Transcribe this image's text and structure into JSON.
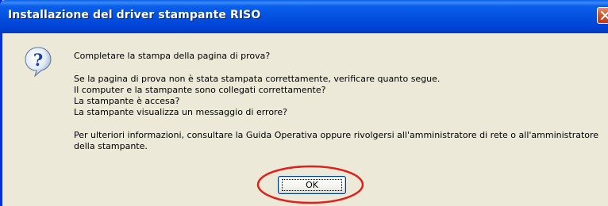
{
  "window": {
    "title": "Installazione del driver stampante RISO"
  },
  "icons": {
    "close": "close-icon",
    "question": "question-icon"
  },
  "message": {
    "question": "Completare la stampa della pagina di prova?",
    "intro": "Se la pagina di prova non è stata stampata correttamente, verificare quanto segue.",
    "checks": [
      " Il computer e la stampante sono collegati correttamente?",
      " La stampante è accesa?",
      " La stampante visualizza un messaggio di errore?"
    ],
    "info_line1": "Per ulteriori informazioni, consultare la Guida Operativa oppure rivolgersi all'amministratore di rete o all'amministratore",
    "info_line2": "della stampante."
  },
  "buttons": {
    "ok_label": "OK"
  },
  "colors": {
    "titlebar": "#0551e0",
    "dialog_bg": "#ece9d8",
    "close_button": "#d9532d",
    "highlight": "#e0201b"
  }
}
